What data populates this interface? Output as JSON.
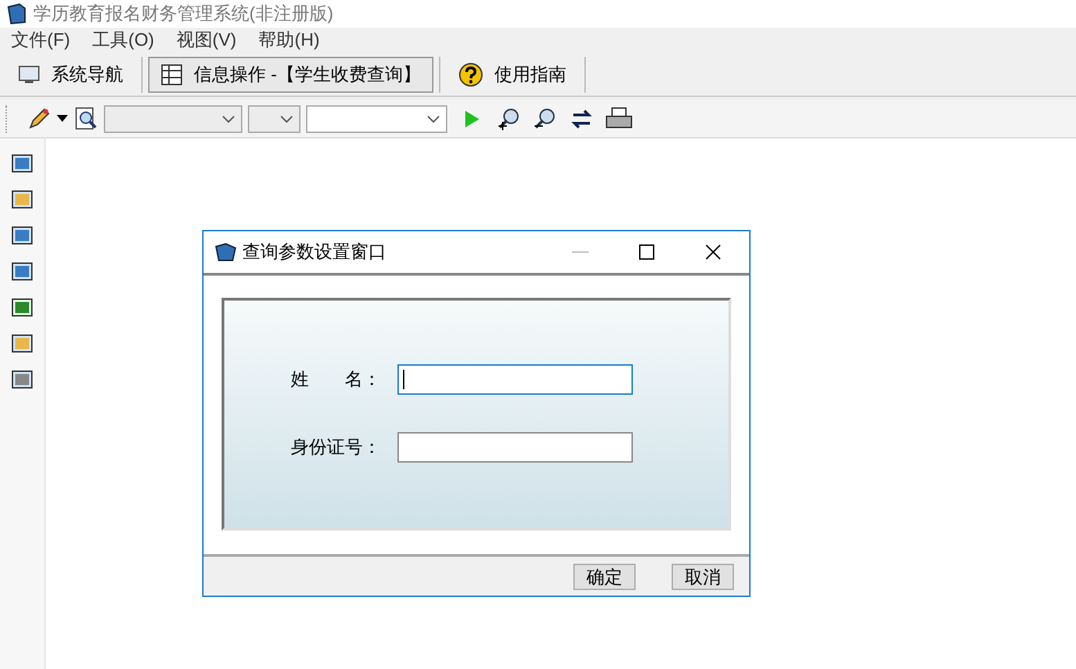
{
  "window": {
    "title": "学历教育报名财务管理系统(非注册版)"
  },
  "menu": [
    "文件(F)",
    "工具(O)",
    "视图(V)",
    "帮助(H)"
  ],
  "tabs": [
    {
      "label": "系统导航",
      "selected": false
    },
    {
      "label": "信息操作 -【学生收费查询】",
      "selected": true
    },
    {
      "label": "使用指南",
      "selected": false
    }
  ],
  "dialog": {
    "title": "查询参数设置窗口",
    "fields": [
      {
        "label": "姓　　名：",
        "focused": true
      },
      {
        "label": "身份证号：",
        "focused": false
      }
    ],
    "buttons": [
      "确定",
      "取消"
    ]
  }
}
